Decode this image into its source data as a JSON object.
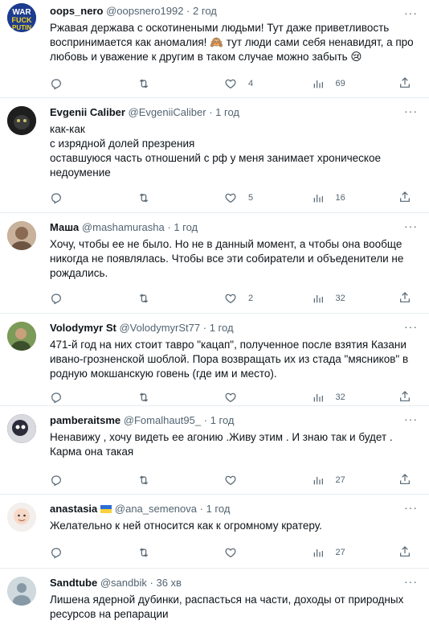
{
  "tweets": [
    {
      "name": "oops_nero",
      "handle": "@oopsnero1992",
      "time": "2 год",
      "lines": [
        "Ржавая держава с оскотинеными людьми! Тут даже приветливость",
        "воспринимается как аномалия! 🙈 тут люди сами себя ненавидят, а про",
        "любовь и уважение к другим в таком случае можно забыть 😢"
      ],
      "replies": "",
      "retweets": "",
      "likes": "4",
      "views": "69",
      "avatar_color": "#1d3c8f",
      "avatar_text": [
        "WAR",
        "FUCK",
        "PUTIN"
      ]
    },
    {
      "name": "Evgenii Caliber",
      "handle": "@EvgeniiCaliber",
      "time": "1 год",
      "lines": [
        "как-как",
        "с изрядной долей презрения",
        "оставшуюся часть отношений с рф у меня занимает хроническое",
        "недоумение"
      ],
      "replies": "",
      "retweets": "",
      "likes": "5",
      "views": "16",
      "avatar_color": "#1e1e1e"
    },
    {
      "name": "Маша",
      "handle": "@mashamurasha",
      "time": "1 год",
      "lines": [
        "Хочу, чтобы ее не было. Но не в данный момент, а чтобы она вообще",
        "никогда не появлялась. Чтобы все эти собиратели и объеденители не",
        "рождались."
      ],
      "replies": "",
      "retweets": "",
      "likes": "2",
      "views": "32",
      "avatar_color": "#a9856a"
    },
    {
      "name": "Volodymyr St",
      "handle": "@VolodymyrSt77",
      "time": "1 год",
      "lines": [
        "471-й год на них стоит тавро \"кацап\", полученное после взятия Казани",
        "ивано-грозненской шоблой. Пора возвращать их из стада \"мясников\" в",
        "родную мокшанскую говень (где им и место)."
      ],
      "replies": "",
      "retweets": "",
      "likes": "",
      "views": "32",
      "avatar_color": "#6f8a4a"
    },
    {
      "name": "pamberaitsme",
      "handle": "@Fomalhaut95_",
      "time": "1 год",
      "lines": [
        "Ненавижу , хочу видеть ее агонию .Живу этим . И знаю так и будет .",
        "Карма она такая"
      ],
      "replies": "",
      "retweets": "",
      "likes": "",
      "views": "27",
      "avatar_color": "#2b2b3a"
    },
    {
      "name": "anastasia",
      "handle": "@ana_semenova",
      "time": "1 год",
      "flag": true,
      "lines": [
        "Желательно к ней относится как к огромному кратеру."
      ],
      "replies": "",
      "retweets": "",
      "likes": "",
      "views": "27",
      "avatar_color": "#e7e2dd"
    },
    {
      "name": "Sandtube",
      "handle": "@sandbik",
      "time": "36 хв",
      "lines": [
        "Лишена ядерной дубинки, распасться на части, доходы от природных",
        "ресурсов на репарации"
      ],
      "replies": "",
      "retweets": "",
      "likes": "",
      "views": "",
      "avatar_color": "#c7ccd1"
    }
  ],
  "icons": {
    "reply": "reply-icon",
    "retweet": "retweet-icon",
    "like": "heart-icon",
    "views": "analytics-icon",
    "share": "share-icon",
    "more": "more-icon"
  }
}
